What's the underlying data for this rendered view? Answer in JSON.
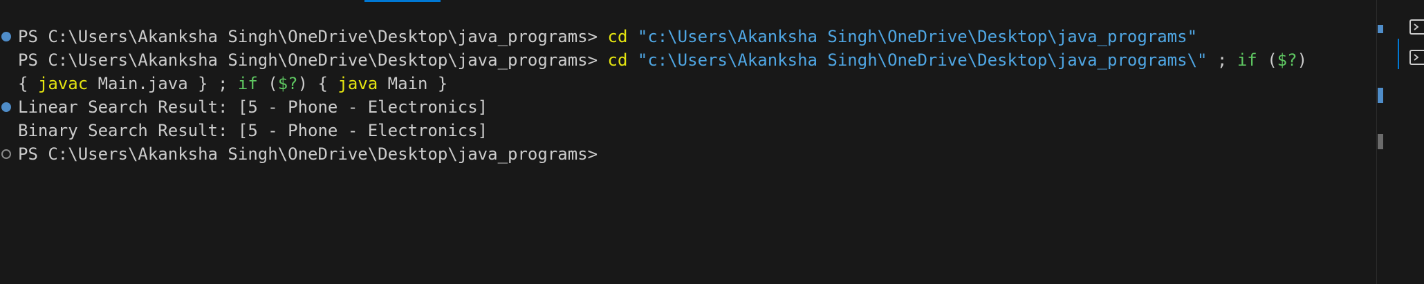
{
  "terminal": {
    "lines": [
      {
        "decoration": "success",
        "segments": [
          {
            "type": "plain",
            "text": "PS C:\\Users\\Akanksha Singh\\OneDrive\\Desktop\\java_programs> "
          },
          {
            "type": "cmd",
            "text": "cd"
          },
          {
            "type": "plain",
            "text": " "
          },
          {
            "type": "str",
            "text": "\"c:\\Users\\Akanksha Singh\\OneDrive\\Desktop\\java_programs\""
          }
        ]
      },
      {
        "decoration": "none",
        "segments": [
          {
            "type": "plain",
            "text": "PS C:\\Users\\Akanksha Singh\\OneDrive\\Desktop\\java_programs> "
          },
          {
            "type": "cmd",
            "text": "cd"
          },
          {
            "type": "plain",
            "text": " "
          },
          {
            "type": "str",
            "text": "\"c:\\Users\\Akanksha Singh\\OneDrive\\Desktop\\java_programs\\\""
          },
          {
            "type": "plain",
            "text": " ; "
          },
          {
            "type": "kw",
            "text": "if"
          },
          {
            "type": "plain",
            "text": " ("
          },
          {
            "type": "var",
            "text": "$?"
          },
          {
            "type": "plain",
            "text": ")"
          }
        ]
      },
      {
        "decoration": "none",
        "segments": [
          {
            "type": "plain",
            "text": "{ "
          },
          {
            "type": "cmd",
            "text": "javac"
          },
          {
            "type": "plain",
            "text": " Main.java } ; "
          },
          {
            "type": "kw",
            "text": "if"
          },
          {
            "type": "plain",
            "text": " ("
          },
          {
            "type": "var",
            "text": "$?"
          },
          {
            "type": "plain",
            "text": ") { "
          },
          {
            "type": "cmd",
            "text": "java"
          },
          {
            "type": "plain",
            "text": " Main }"
          }
        ]
      },
      {
        "decoration": "success",
        "segments": [
          {
            "type": "plain",
            "text": "Linear Search Result: [5 - Phone - Electronics]"
          }
        ]
      },
      {
        "decoration": "none",
        "segments": [
          {
            "type": "plain",
            "text": "Binary Search Result: [5 - Phone - Electronics]"
          }
        ]
      },
      {
        "decoration": "default",
        "segments": [
          {
            "type": "plain",
            "text": "PS C:\\Users\\Akanksha Singh\\OneDrive\\Desktop\\java_programs>"
          }
        ]
      }
    ]
  },
  "side_panel": {
    "icons": [
      "terminal-powershell-icon",
      "terminal-powershell-icon"
    ]
  },
  "colors": {
    "background": "#181818",
    "text": "#cccccc",
    "command": "#e5e510",
    "string": "#4fa6e3",
    "keyword": "#5fc862",
    "accent": "#0078d4"
  }
}
